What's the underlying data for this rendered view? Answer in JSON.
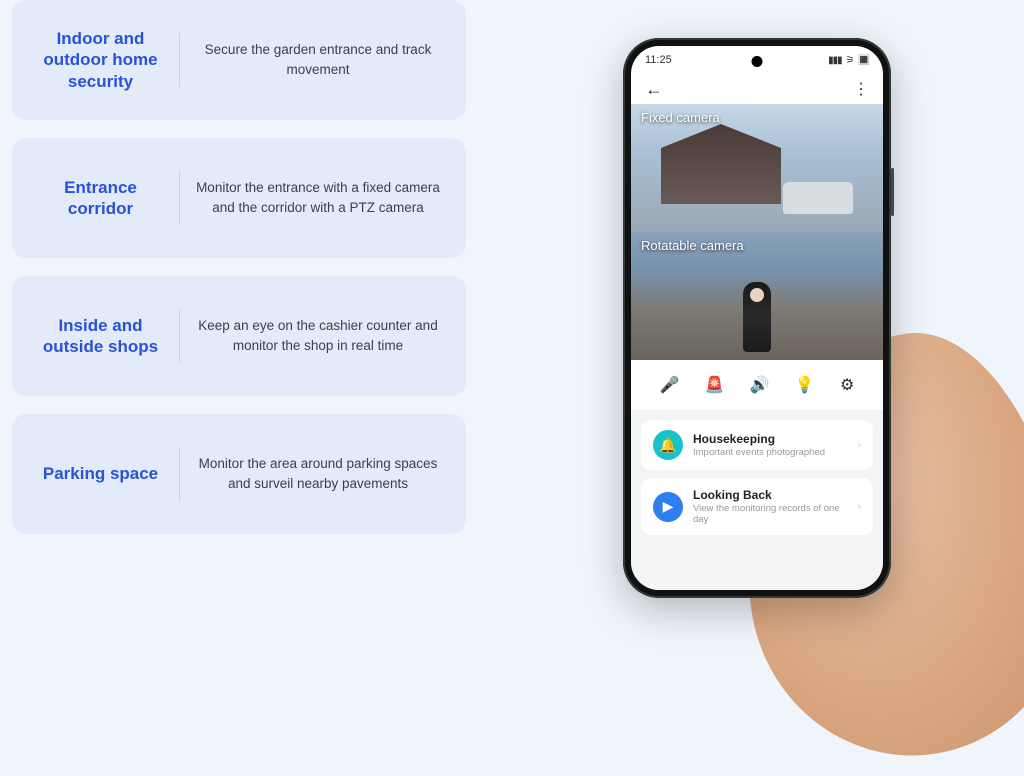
{
  "features": [
    {
      "title": "Indoor and outdoor home security",
      "desc": "Secure the garden entrance and track movement"
    },
    {
      "title": "Entrance corridor",
      "desc": "Monitor the entrance with a fixed camera and the corridor with a PTZ camera"
    },
    {
      "title": "Inside and outside shops",
      "desc": "Keep an eye on the cashier counter and monitor the shop in real time"
    },
    {
      "title": "Parking space",
      "desc": "Monitor the area around parking spaces and surveil nearby pavements"
    }
  ],
  "phone": {
    "time": "11:25",
    "feeds": [
      {
        "label": "Fixed camera"
      },
      {
        "label": "Rotatable camera"
      }
    ],
    "list": [
      {
        "title": "Housekeeping",
        "sub": "Important events photographed"
      },
      {
        "title": "Looking Back",
        "sub": "View the monitoring records of one day"
      }
    ]
  }
}
